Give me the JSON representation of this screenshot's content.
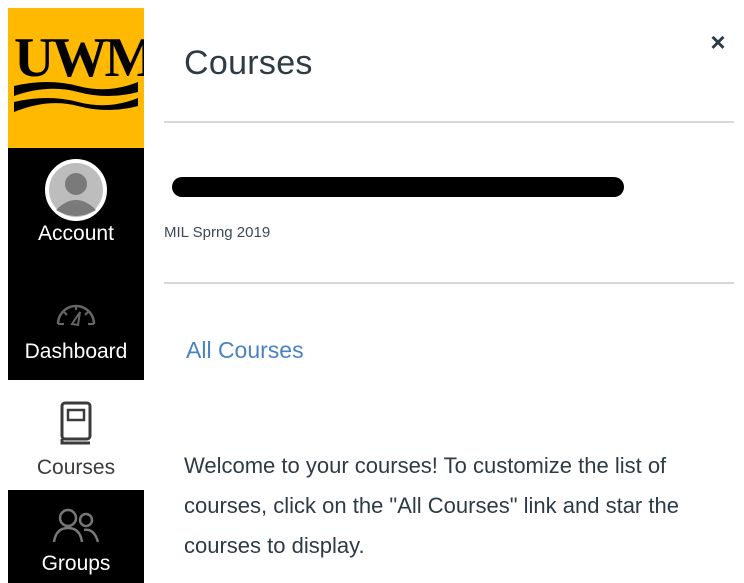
{
  "nav": {
    "logo_text": "UWM",
    "items": [
      {
        "label": "Account",
        "icon": "account-avatar-icon"
      },
      {
        "label": "Dashboard",
        "icon": "dashboard-gauge-icon"
      },
      {
        "label": "Courses",
        "icon": "courses-book-icon"
      },
      {
        "label": "Groups",
        "icon": "groups-people-icon"
      }
    ]
  },
  "tray": {
    "close_label": "×",
    "title": "Courses",
    "course": {
      "name": "",
      "term": "MIL Sprng 2019"
    },
    "all_courses_label": "All Courses",
    "welcome_text": "Welcome to your courses! To customize the list of courses, click on the \"All Courses\" link and star the courses to display."
  },
  "colors": {
    "brand_gold": "#ffb900",
    "nav_bg": "#000000",
    "link": "#4a83c3",
    "text": "#2d3b45"
  }
}
